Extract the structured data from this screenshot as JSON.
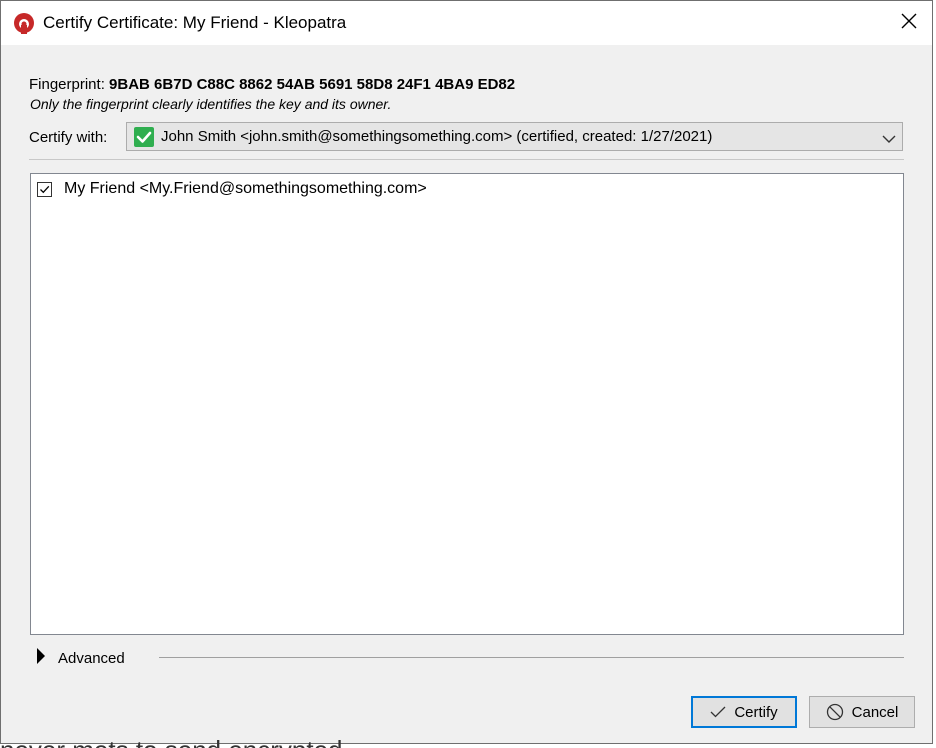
{
  "window": {
    "title": "Certify Certificate: My Friend - Kleopatra"
  },
  "fingerprint": {
    "label": "Fingerprint:",
    "value": "9BAB 6B7D C88C 8862 54AB 5691 58D8 24F1 4BA9 ED82",
    "hint": "Only the fingerprint clearly identifies the key and its owner."
  },
  "certify_with": {
    "label": "Certify with:",
    "selected": "John Smith <john.smith@somethingsomething.com> (certified,  created: 1/27/2021)"
  },
  "user_ids": [
    {
      "label": "My Friend <My.Friend@somethingsomething.com>",
      "checked": true
    }
  ],
  "advanced": {
    "label": "Advanced",
    "expanded": false
  },
  "buttons": {
    "certify": "Certify",
    "cancel": "Cancel"
  },
  "background_text": "never mets to send encrypted",
  "colors": {
    "focus_border": "#0078d7",
    "check_green": "#2fae4f",
    "brand_red": "#c0392b"
  }
}
